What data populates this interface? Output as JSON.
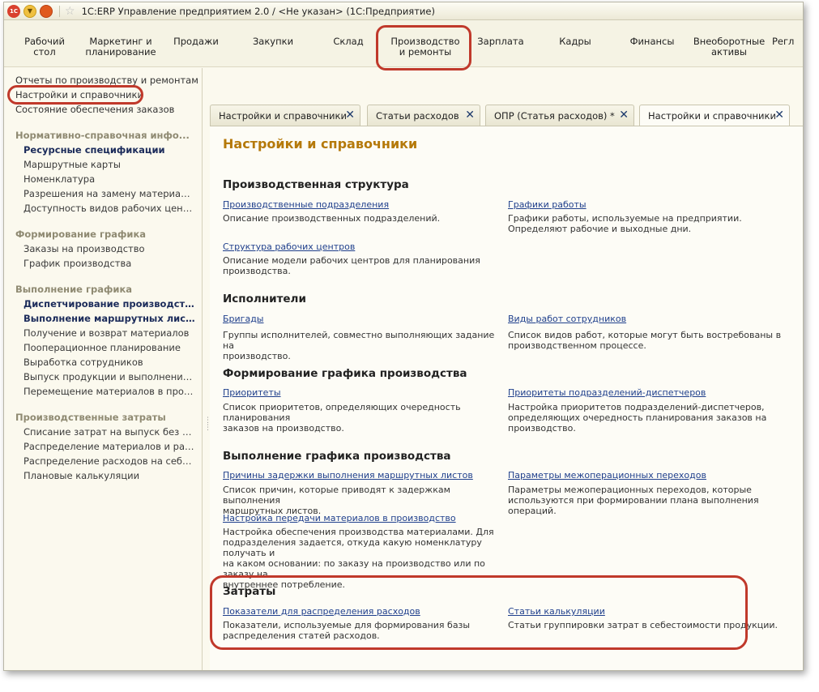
{
  "window": {
    "title": "1C:ERP Управление предприятием 2.0 / <Не указан> (1С:Предприятие)",
    "logo_text": "1С"
  },
  "sections": [
    {
      "label": "Рабочий\nстол"
    },
    {
      "label": "Маркетинг и\nпланирование"
    },
    {
      "label": "Продажи"
    },
    {
      "label": "Закупки"
    },
    {
      "label": "Склад"
    },
    {
      "label": "Производство\nи ремонты"
    },
    {
      "label": "Зарплата"
    },
    {
      "label": "Кадры"
    },
    {
      "label": "Финансы"
    },
    {
      "label": "Внеоборотные\nактивы"
    },
    {
      "label": "Регл"
    }
  ],
  "left_panel": {
    "top_links": [
      "Отчеты по производству и ремонтам",
      "Настройки и справочники",
      "Состояние обеспечения заказов"
    ],
    "groups": [
      {
        "title": "Нормативно-справочная инфо...",
        "items": [
          {
            "label": "Ресурсные спецификации",
            "bold": true
          },
          {
            "label": "Маршрутные карты",
            "bold": false
          },
          {
            "label": "Номенклатура",
            "bold": false
          },
          {
            "label": "Разрешения на замену материалов",
            "bold": false
          },
          {
            "label": "Доступность видов рабочих центров",
            "bold": false
          }
        ]
      },
      {
        "title": "Формирование графика",
        "items": [
          {
            "label": "Заказы на производство",
            "bold": false
          },
          {
            "label": "График производства",
            "bold": false
          }
        ]
      },
      {
        "title": "Выполнение графика",
        "items": [
          {
            "label": "Диспетчирование производства",
            "bold": true
          },
          {
            "label": "Выполнение маршрутных листов",
            "bold": true
          },
          {
            "label": "Получение и возврат материалов",
            "bold": false
          },
          {
            "label": "Пооперационное планирование",
            "bold": false
          },
          {
            "label": "Выработка сотрудников",
            "bold": false
          },
          {
            "label": "Выпуск продукции и выполнение работ",
            "bold": false
          },
          {
            "label": "Перемещение материалов в производ...",
            "bold": false
          }
        ]
      },
      {
        "title": "Производственные затраты",
        "items": [
          {
            "label": "Списание затрат на выпуск без распо...",
            "bold": false
          },
          {
            "label": "Распределение материалов и работ",
            "bold": false
          },
          {
            "label": "Распределение расходов на себестои...",
            "bold": false
          },
          {
            "label": "Плановые калькуляции",
            "bold": false
          }
        ]
      }
    ]
  },
  "tabs": [
    {
      "label": "Настройки и справочники",
      "active": false
    },
    {
      "label": "Статьи расходов",
      "active": false
    },
    {
      "label": "ОПР (Статья расходов) *",
      "active": false
    },
    {
      "label": "Настройки и справочники",
      "active": true
    }
  ],
  "tab_close_glyph": "✕",
  "content": {
    "title": "Настройки и справочники",
    "sections": [
      {
        "heading": "Производственная структура",
        "entries": [
          {
            "link": "Производственные подразделения",
            "desc": "Описание производственных подразделений."
          },
          {
            "link": "Графики работы",
            "desc": "Графики работы, используемые на предприятии.\nОпределяют рабочие и выходные дни."
          },
          {
            "link": "Структура рабочих центров",
            "desc": "Описание модели рабочих центров для планирования\nпроизводства."
          }
        ]
      },
      {
        "heading": "Исполнители",
        "entries": [
          {
            "link": "Бригады",
            "desc": "Группы исполнителей, совместно выполняющих задание на\nпроизводство."
          },
          {
            "link": "Виды работ сотрудников",
            "desc": "Список видов работ, которые могут быть востребованы в\nпроизводственном процессе."
          }
        ]
      },
      {
        "heading": "Формирование графика производства",
        "entries": [
          {
            "link": "Приоритеты",
            "desc": "Список приоритетов, определяющих очередность планирования\nзаказов на производство."
          },
          {
            "link": "Приоритеты подразделений-диспетчеров",
            "desc": "Настройка приоритетов подразделений-диспетчеров,\nопределяющих очередность планирования заказов на\nпроизводство."
          }
        ]
      },
      {
        "heading": "Выполнение графика производства",
        "entries": [
          {
            "link": "Причины задержки выполнения маршрутных листов",
            "desc": "Список причин, которые приводят к задержкам выполнения\nмаршрутных листов."
          },
          {
            "link": "Параметры межоперационных переходов",
            "desc": "Параметры межоперационных переходов, которые\nиспользуются при формировании плана выполнения операций."
          },
          {
            "link": "Настройка передачи материалов в производство",
            "desc": "Настройка обеспечения производства материалами. Для\nподразделения задается, откуда какую номенклатуру получать и\nна каком основании: по заказу на производство или по заказу на\nвнутреннее потребление."
          }
        ]
      },
      {
        "heading": "Затраты",
        "entries": [
          {
            "link": "Показатели для распределения расходов",
            "desc": "Показатели, используемые для формирования базы\nраспределения статей расходов."
          },
          {
            "link": "Статьи калькуляции",
            "desc": "Статьи группировки затрат в себестоимости продукции."
          }
        ]
      }
    ]
  },
  "colors": {
    "highlight": "#c0392b",
    "page_title": "#b5790a",
    "link": "#1f3f8c"
  }
}
